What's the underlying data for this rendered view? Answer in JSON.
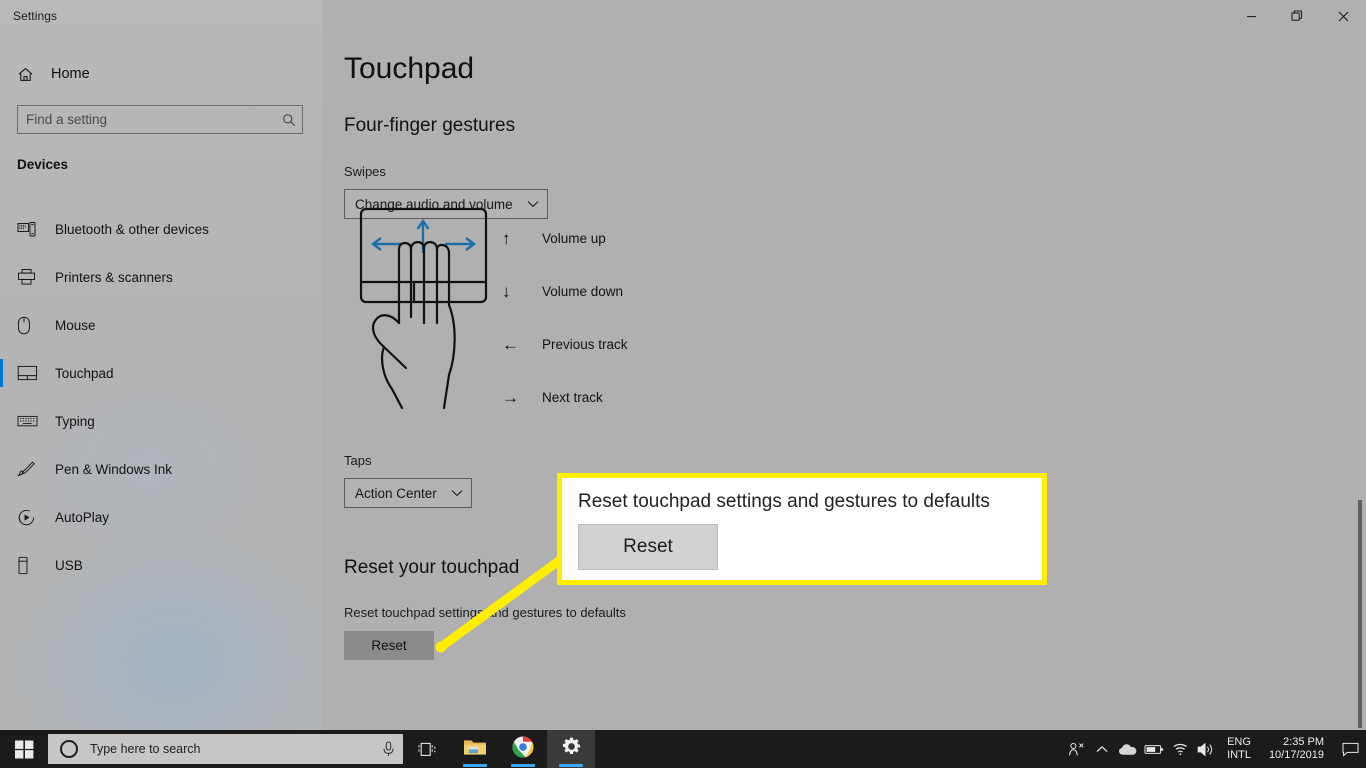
{
  "window": {
    "title": "Settings",
    "minimize_label": "Minimize",
    "restore_label": "Restore",
    "close_label": "Close"
  },
  "sidebar": {
    "home_label": "Home",
    "search": {
      "placeholder": "Find a setting",
      "value": ""
    },
    "section_header": "Devices",
    "items": [
      {
        "label": "Bluetooth & other devices",
        "icon": "bluetooth-devices-icon",
        "selected": false
      },
      {
        "label": "Printers & scanners",
        "icon": "printer-icon",
        "selected": false
      },
      {
        "label": "Mouse",
        "icon": "mouse-icon",
        "selected": false
      },
      {
        "label": "Touchpad",
        "icon": "touchpad-icon",
        "selected": true
      },
      {
        "label": "Typing",
        "icon": "keyboard-icon",
        "selected": false
      },
      {
        "label": "Pen & Windows Ink",
        "icon": "pen-icon",
        "selected": false
      },
      {
        "label": "AutoPlay",
        "icon": "autoplay-icon",
        "selected": false
      },
      {
        "label": "USB",
        "icon": "usb-icon",
        "selected": false
      }
    ]
  },
  "main": {
    "page_title": "Touchpad",
    "group_title": "Four-finger gestures",
    "swipes_label": "Swipes",
    "swipes_value": "Change audio and volume",
    "taps_label": "Taps",
    "taps_value": "Action Center",
    "gestures": [
      {
        "arrow": "↑",
        "icon": "arrow-up-icon",
        "label": "Volume up"
      },
      {
        "arrow": "↓",
        "icon": "arrow-down-icon",
        "label": "Volume down"
      },
      {
        "arrow": "←",
        "icon": "arrow-left-icon",
        "label": "Previous track"
      },
      {
        "arrow": "→",
        "icon": "arrow-right-icon",
        "label": "Next track"
      }
    ],
    "reset_section_title": "Reset your touchpad",
    "reset_description": "Reset touchpad settings and gestures to defaults",
    "reset_button": "Reset"
  },
  "callout": {
    "description": "Reset touchpad settings and gestures to defaults",
    "button_label": "Reset",
    "border_color": "#ffee00",
    "background_color": "#ffffff"
  },
  "colors": {
    "accent": "#0078d7",
    "highlight": "#ffee00",
    "taskbar": "#1b1b1b",
    "window_bg": "#b0b0b0"
  },
  "taskbar": {
    "start_label": "Start",
    "search_placeholder": "Type here to search",
    "mic_icon": "microphone-icon",
    "task_view_label": "Task View",
    "apps": [
      {
        "name": "file-explorer-icon",
        "label": "File Explorer",
        "running": true,
        "active": false
      },
      {
        "name": "chrome-icon",
        "label": "Google Chrome",
        "running": true,
        "active": false
      },
      {
        "name": "settings-gear-icon",
        "label": "Settings",
        "running": true,
        "active": true
      }
    ],
    "tray": {
      "icons": [
        {
          "name": "meet-now-icon",
          "label": "Meet Now"
        },
        {
          "name": "show-hidden-icons-chevron",
          "label": "Show hidden icons"
        },
        {
          "name": "onedrive-cloud-icon",
          "label": "OneDrive"
        },
        {
          "name": "battery-icon",
          "label": "Battery"
        },
        {
          "name": "wifi-icon",
          "label": "Network"
        },
        {
          "name": "volume-icon",
          "label": "Volume"
        }
      ],
      "language_line1": "ENG",
      "language_line2": "INTL",
      "time": "2:35 PM",
      "date": "10/17/2019",
      "notification_icon": "action-center-icon"
    }
  }
}
